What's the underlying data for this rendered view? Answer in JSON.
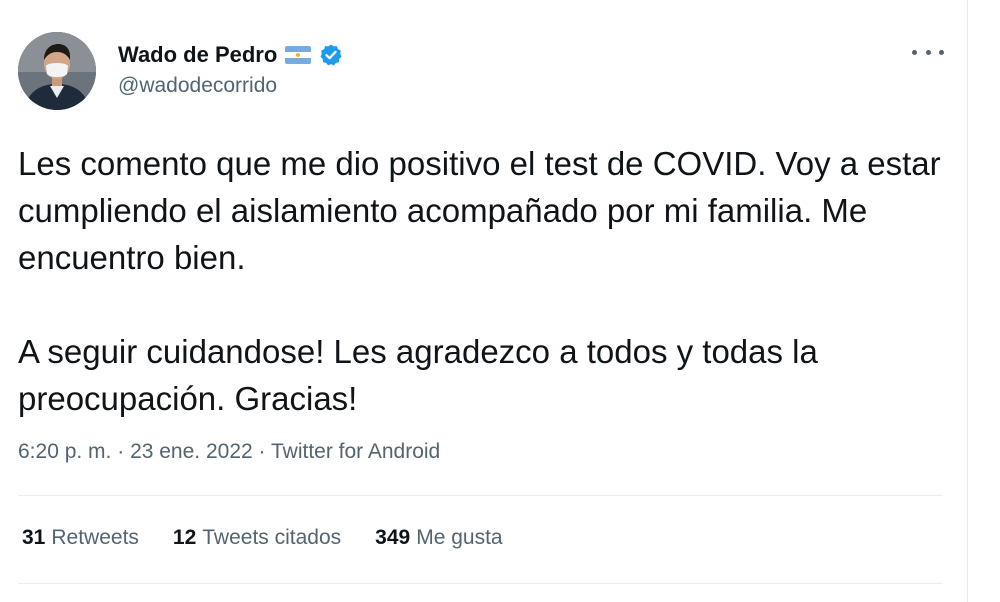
{
  "author": {
    "name": "Wado de Pedro",
    "handle": "@wadodecorrido",
    "verified": true,
    "flag_icon": "argentina-flag-icon",
    "verified_icon": "verified-badge-icon"
  },
  "tweet": {
    "paragraph1": "Les comento que me dio positivo el test de COVID. Voy a estar cumpliendo el aislamiento acompañado por mi familia. Me encuentro bien.",
    "paragraph2": "A seguir cuidandose! Les agradezco a todos y todas la preocupación. Gracias!"
  },
  "meta": {
    "time": "6:20 p. m.",
    "separator": " · ",
    "date": "23 ene. 2022",
    "source": "Twitter for Android"
  },
  "stats": {
    "retweets_count": "31",
    "retweets_label": "Retweets",
    "quotes_count": "12",
    "quotes_label": "Tweets citados",
    "likes_count": "349",
    "likes_label": "Me gusta"
  },
  "colors": {
    "text": "#0f1419",
    "secondary": "#536471",
    "verified": "#1d9bf0",
    "divider": "#e6ecf0",
    "flag_blue": "#74acdf",
    "flag_sun": "#f6b40e"
  }
}
